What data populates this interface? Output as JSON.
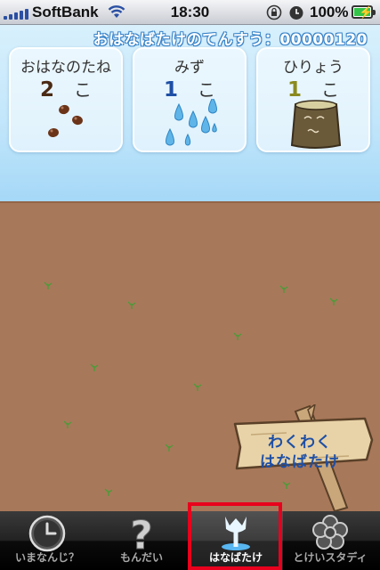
{
  "status_bar": {
    "carrier": "SoftBank",
    "time": "18:30",
    "battery_percent": "100%",
    "battery_level": 1.0
  },
  "score": {
    "label": "おはなばたけのてんすう：",
    "value": "00000120"
  },
  "inventory": [
    {
      "name": "おはなのたね",
      "count": "2",
      "unit": "こ",
      "color": "#4a2a14",
      "icon": "seeds-icon"
    },
    {
      "name": "みず",
      "count": "1",
      "unit": "こ",
      "color": "#1e4fa5",
      "icon": "water-drops-icon"
    },
    {
      "name": "ひりょう",
      "count": "1",
      "unit": "こ",
      "color": "#8a8a1e",
      "icon": "fertilizer-bag-icon"
    }
  ],
  "sign": {
    "line1": "わくわく",
    "line2": "はなばたけ"
  },
  "tabs": [
    {
      "label": "いまなんじ？",
      "icon": "clock-icon",
      "active": false
    },
    {
      "label": "もんだい",
      "icon": "question-mark-icon",
      "active": false
    },
    {
      "label": "はなばたけ",
      "icon": "flower-icon",
      "active": true
    },
    {
      "label": "とけいスタディ",
      "icon": "flower-outline-icon",
      "active": false
    }
  ],
  "colors": {
    "sky": "#c2e6fb",
    "soil": "#a8785a",
    "highlight": "#e8001c",
    "sign_text": "#1e4fa5"
  }
}
